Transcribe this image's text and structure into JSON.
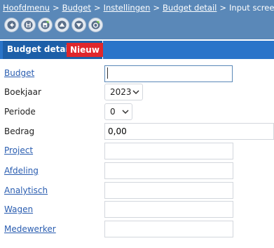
{
  "breadcrumb": {
    "items": [
      {
        "label": "Hoofdmenu",
        "link": true
      },
      {
        "label": "Budget",
        "link": true
      },
      {
        "label": "Instellingen",
        "link": true
      },
      {
        "label": "Budget detail",
        "link": true
      },
      {
        "label": "Input screen",
        "link": false
      }
    ],
    "separator": ">"
  },
  "toolbar": {
    "buttons": [
      {
        "name": "back-icon"
      },
      {
        "name": "save-icon"
      },
      {
        "name": "save-new-icon"
      },
      {
        "name": "up-icon"
      },
      {
        "name": "down-icon"
      },
      {
        "name": "refresh-icon"
      }
    ]
  },
  "tabs": {
    "title": "Budget detail",
    "badge": "Nieuw"
  },
  "form": {
    "budget": {
      "label": "Budget",
      "value": ""
    },
    "boekjaar": {
      "label": "Boekjaar",
      "value": "2023"
    },
    "periode": {
      "label": "Periode",
      "value": "0"
    },
    "bedrag": {
      "label": "Bedrag",
      "value": "0,00"
    },
    "project": {
      "label": "Project",
      "value": ""
    },
    "afdeling": {
      "label": "Afdeling",
      "value": ""
    },
    "analytisch": {
      "label": "Analytisch",
      "value": ""
    },
    "wagen": {
      "label": "Wagen",
      "value": ""
    },
    "medewerker": {
      "label": "Medewerker",
      "value": ""
    }
  },
  "colors": {
    "topbar": "#5a88b8",
    "tabbar": "#2a74c9",
    "tab_active": "#1d5fa8",
    "badge": "#e0262b",
    "link": "#2a5db0"
  }
}
